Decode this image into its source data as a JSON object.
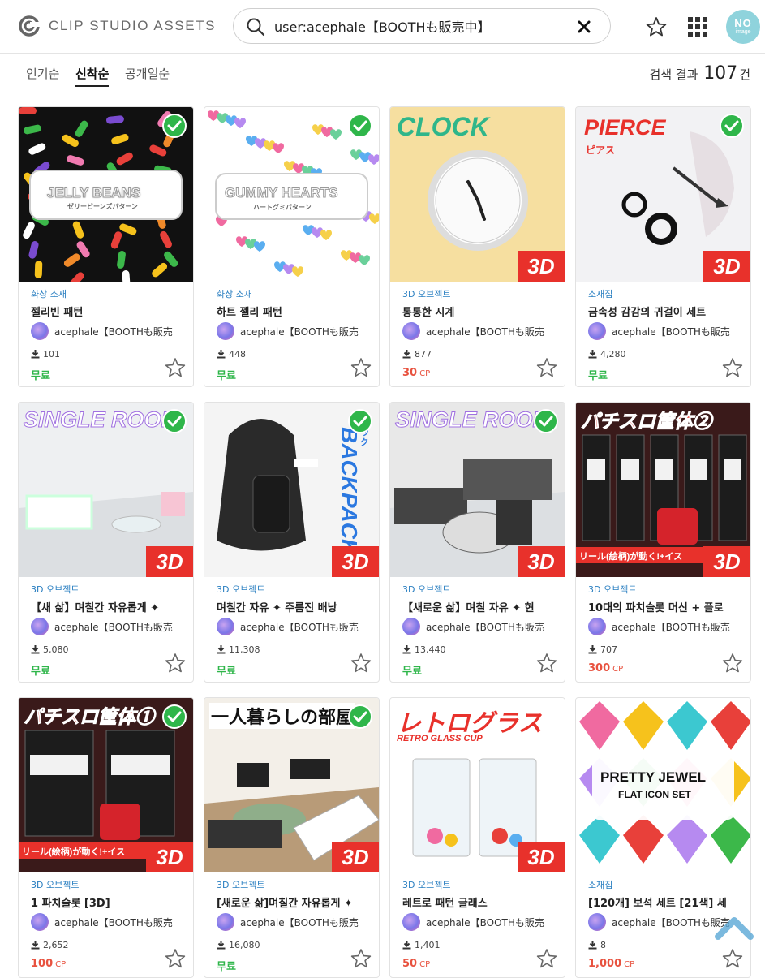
{
  "header": {
    "logo_text": "CLIP STUDIO ASSETS",
    "search_value": "user:acephale【BOOTHも販売中】",
    "avatar_text": "NO",
    "avatar_sub": "image"
  },
  "sort": {
    "tabs": [
      "인기순",
      "신착순",
      "공개일순"
    ],
    "active": "신착순",
    "result_prefix": "검색 결과",
    "result_count": "107",
    "result_suffix": "건"
  },
  "cards": [
    {
      "category": "화상 소재",
      "title": "젤리빈 패턴",
      "author": "acephale【BOOTHも販売",
      "downloads": "101",
      "price": "무료",
      "price_unit": "",
      "paid": false,
      "checked": true,
      "is3d": false,
      "art": {
        "kind": "jelly",
        "bg": "#111111",
        "label": "JELLY BEANS",
        "sub": "ゼリービーンズパターン"
      }
    },
    {
      "category": "화상 소재",
      "title": "하트 젤리 패턴",
      "author": "acephale【BOOTHも販売",
      "downloads": "448",
      "price": "무료",
      "price_unit": "",
      "paid": false,
      "checked": true,
      "is3d": false,
      "art": {
        "kind": "hearts",
        "bg": "#ffffff",
        "label": "GUMMY HEARTS",
        "sub": "ハートグミパターン"
      }
    },
    {
      "category": "3D 오브젝트",
      "title": "통통한 시계",
      "author": "acephale【BOOTHも販売",
      "downloads": "877",
      "price": "30",
      "price_unit": "CP",
      "paid": true,
      "checked": false,
      "is3d": true,
      "art": {
        "kind": "clock",
        "bg": "#f6dfa0",
        "label": "CLOCK",
        "sub": ""
      }
    },
    {
      "category": "소재집",
      "title": "금속성 감감의 귀걸이 세트",
      "author": "acephale【BOOTHも販売",
      "downloads": "4,280",
      "price": "무료",
      "price_unit": "",
      "paid": false,
      "checked": true,
      "is3d": true,
      "art": {
        "kind": "pierce",
        "bg": "#f2f2f4",
        "label": "PIERCE",
        "sub": "ピアス"
      }
    },
    {
      "category": "3D 오브젝트",
      "title": "【새 삶】며칠간 자유롭게 ✦",
      "author": "acephale【BOOTHも販売",
      "downloads": "5,080",
      "price": "무료",
      "price_unit": "",
      "paid": false,
      "checked": true,
      "is3d": true,
      "art": {
        "kind": "room1",
        "bg": "#eef0f2",
        "label": "SINGLE ROOM",
        "sub": ""
      }
    },
    {
      "category": "3D 오브젝트",
      "title": "며칠간 자유 ✦ 주름진 배낭",
      "author": "acephale【BOOTHも販売",
      "downloads": "11,308",
      "price": "무료",
      "price_unit": "",
      "paid": false,
      "checked": true,
      "is3d": true,
      "art": {
        "kind": "backpack",
        "bg": "#f4f4f4",
        "label": "BACKPACK",
        "sub": "リュック"
      }
    },
    {
      "category": "3D 오브젝트",
      "title": "【새로운 삶】며칠 자유 ✦ 현",
      "author": "acephale【BOOTHも販売",
      "downloads": "13,440",
      "price": "무료",
      "price_unit": "",
      "paid": false,
      "checked": true,
      "is3d": true,
      "art": {
        "kind": "room2",
        "bg": "#e8e8e8",
        "label": "SINGLE ROOM",
        "sub": ""
      }
    },
    {
      "category": "3D 오브젝트",
      "title": "10대의 파치슬롯 머신 + 플로",
      "author": "acephale【BOOTHも販売",
      "downloads": "707",
      "price": "300",
      "price_unit": "CP",
      "paid": true,
      "checked": false,
      "is3d": true,
      "art": {
        "kind": "slots",
        "bg": "#2a1a1a",
        "label": "パチスロ筐体②",
        "sub": "リール(絵柄)が動く!+イス"
      }
    },
    {
      "category": "3D 오브젝트",
      "title": "1 파치슬롯 [3D]",
      "author": "acephale【BOOTHも販売",
      "downloads": "2,652",
      "price": "100",
      "price_unit": "CP",
      "paid": true,
      "checked": true,
      "is3d": true,
      "art": {
        "kind": "slot1",
        "bg": "#2a1a1a",
        "label": "パチスロ筐体①",
        "sub": "リール(絵柄)が動く!+イス"
      }
    },
    {
      "category": "3D 오브젝트",
      "title": "[새로운 삶]며칠간 자유롭게 ✦",
      "author": "acephale【BOOTHも販売",
      "downloads": "16,080",
      "price": "무료",
      "price_unit": "",
      "paid": false,
      "checked": true,
      "is3d": true,
      "art": {
        "kind": "room3",
        "bg": "#f3efe8",
        "label": "一人暮らしの部屋",
        "sub": ""
      }
    },
    {
      "category": "3D 오브젝트",
      "title": "레트로 패턴 글래스",
      "author": "acephale【BOOTHも販売",
      "downloads": "1,401",
      "price": "50",
      "price_unit": "CP",
      "paid": true,
      "checked": false,
      "is3d": true,
      "art": {
        "kind": "glass",
        "bg": "#ffffff",
        "label": "レトログラス",
        "sub": "RETRO GLASS CUP"
      }
    },
    {
      "category": "소재집",
      "title": "[120개] 보석 세트 [21색] 세",
      "author": "acephale【BOOTHも販売",
      "downloads": "8",
      "price": "1,000",
      "price_unit": "CP",
      "paid": true,
      "checked": false,
      "is3d": false,
      "art": {
        "kind": "jewel",
        "bg": "#ffffff",
        "label": "PRETTY JEWEL",
        "sub": "FLAT ICON SET"
      }
    }
  ],
  "icons": {
    "search": "search-icon",
    "clear": "close-icon",
    "favorite": "star-icon",
    "apps": "grid-icon",
    "download": "download-icon",
    "check": "check-icon",
    "scroll_top": "chevron-up-icon"
  },
  "colors": {
    "accent_blue": "#2a7fc1",
    "free_green": "#2fb64a",
    "paid_red": "#e8523f",
    "badge_red": "#e8312b"
  }
}
